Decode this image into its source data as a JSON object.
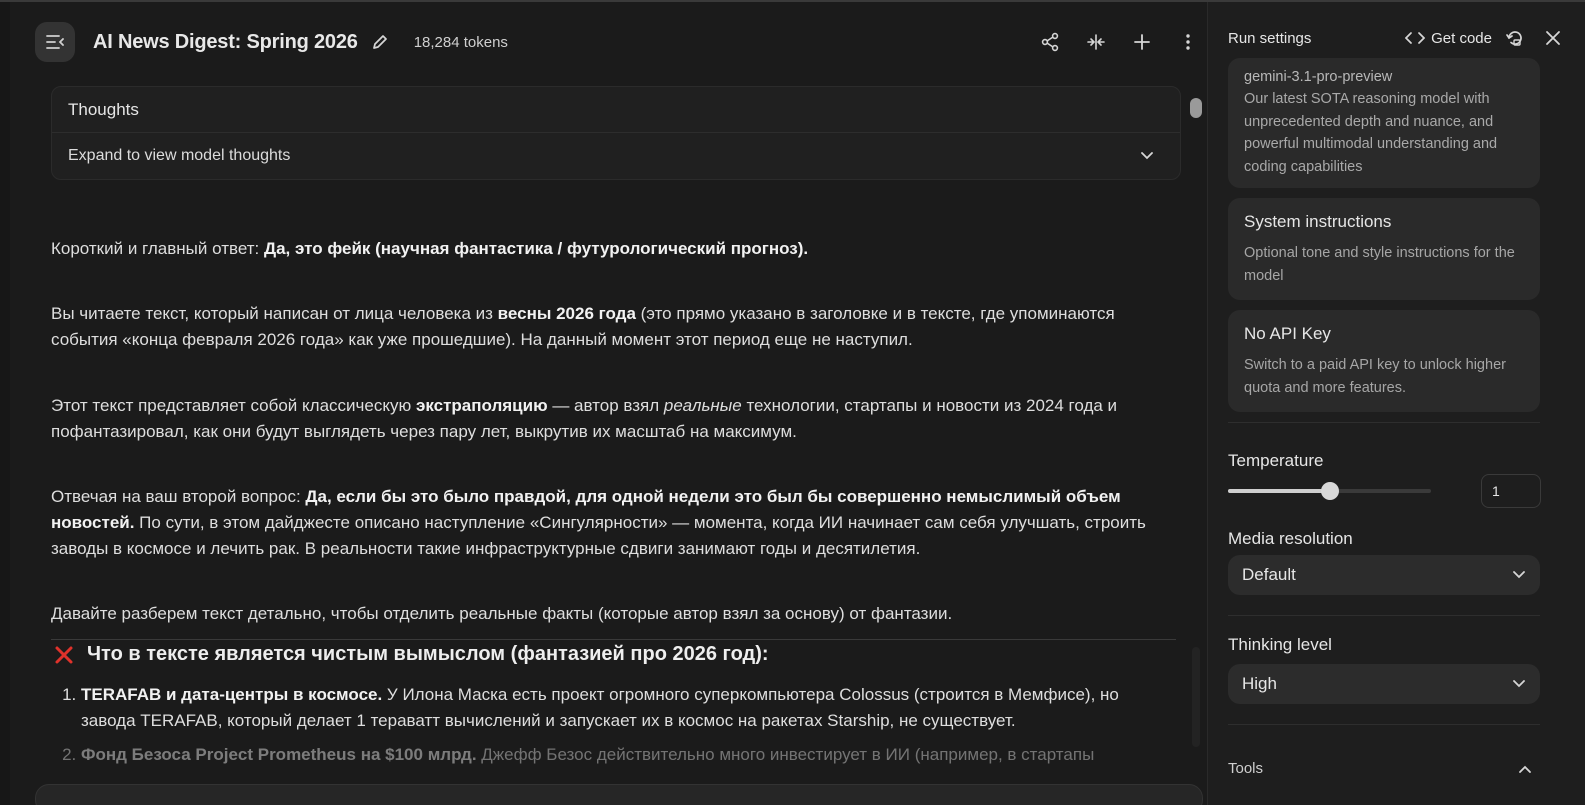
{
  "header": {
    "title": "AI News Digest: Spring 2026",
    "tokens": "18,284 tokens"
  },
  "thoughts": {
    "title": "Thoughts",
    "expand_label": "Expand to view model thoughts"
  },
  "response": {
    "p1_plain": "Короткий и главный ответ: ",
    "p1_bold": "Да, это фейк (научная фантастика / футурологический прогноз).",
    "p2_a": "Вы читаете текст, который написан от лица человека из ",
    "p2_bold": "весны 2026 года",
    "p2_b": " (это прямо указано в заголовке и в тексте, где упоминаются события «конца февраля 2026 года» как уже прошедшие). На данный момент этот период еще не наступил.",
    "p3_a": "Этот текст представляет собой классическую ",
    "p3_bold": "экстраполяцию",
    "p3_b": " — автор взял ",
    "p3_italic": "реальные",
    "p3_c": " технологии, стартапы и новости из 2024 года и пофантазировал, как они будут выглядеть через пару лет, выкрутив их масштаб на максимум.",
    "p4_a": "Отвечая на ваш второй вопрос: ",
    "p4_bold": "Да, если бы это было правдой, для одной недели это был бы совершенно немыслимый объем новостей.",
    "p4_b": " По сути, в этом дайджесте описано наступление «Сингулярности» — момента, когда ИИ начинает сам себя улучшать, строить заводы в космосе и лечить рак. В реальности такие инфраструктурные сдвиги занимают годы и десятилетия.",
    "p5": "Давайте разберем текст детально, чтобы отделить реальные факты (которые автор взял за основу) от фантазии.",
    "h2": "Что в тексте является чистым вымыслом (фантазией про 2026 год):",
    "list": [
      {
        "bold": "TERAFAB и дата-центры в космосе.",
        "text": " У Илона Маска есть проект огромного суперкомпьютера Colossus (строится в Мемфисе), но завода TERAFAB, который делает 1 тераватт вычислений и запускает их в космос на ракетах Starship, не существует."
      },
      {
        "bold": "Фонд Безоса Project Prometheus на $100 млрд.",
        "text": " Джефф Безос действительно много инвестирует в ИИ (например, в стартапы"
      }
    ]
  },
  "panel": {
    "title": "Run settings",
    "get_code": "Get code",
    "model_id": "gemini-3.1-pro-preview",
    "model_desc": "Our latest SOTA reasoning model with unprecedented depth and nuance, and powerful multimodal understanding and coding capabilities",
    "sys_title": "System instructions",
    "sys_desc": "Optional tone and style instructions for the model",
    "key_title": "No API Key",
    "key_desc": "Switch to a paid API key to unlock higher quota and more features.",
    "temperature_label": "Temperature",
    "temperature_value": "1",
    "temperature_fraction": 0.5,
    "media_label": "Media resolution",
    "media_value": "Default",
    "thinking_label": "Thinking level",
    "thinking_value": "High",
    "tools_label": "Tools"
  }
}
